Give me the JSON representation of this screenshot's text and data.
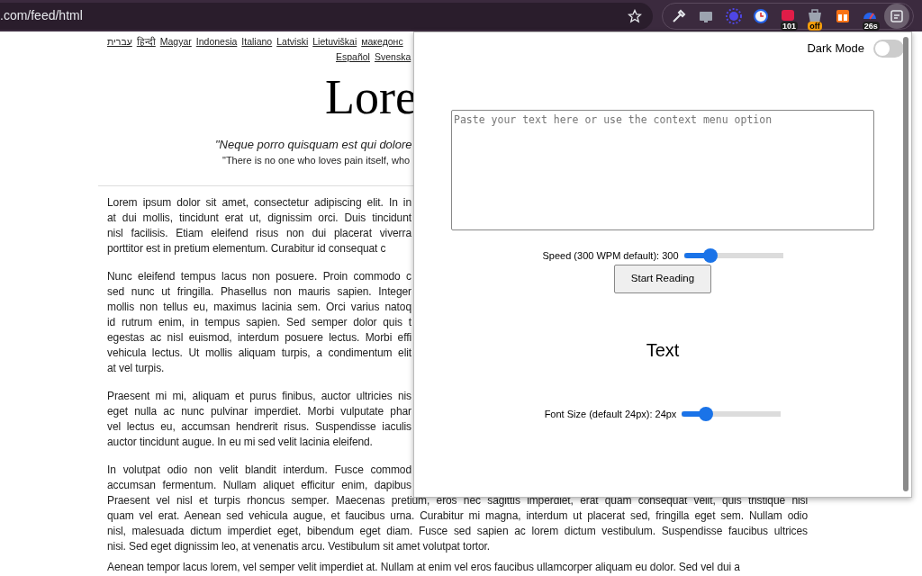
{
  "browser": {
    "url": ".com/feed/html",
    "extensions": [
      {
        "kind": "eyedropper"
      },
      {
        "kind": "screen"
      },
      {
        "kind": "sun"
      },
      {
        "kind": "clock"
      },
      {
        "kind": "calendar",
        "badge": "101"
      },
      {
        "kind": "bag",
        "badge": "off"
      },
      {
        "kind": "grid"
      },
      {
        "kind": "gauge",
        "badge": "26s"
      },
      {
        "kind": "reader",
        "selected": true
      }
    ]
  },
  "page": {
    "languages": [
      [
        "עברית",
        "हिन्दी",
        "Magyar",
        "Indonesia",
        "Italiano",
        "Latviski",
        "Lietuviškai",
        "македонс"
      ],
      [
        "Español",
        "Svenska"
      ]
    ],
    "title": "Lore",
    "quote": "\"Neque porro quisquam est qui dolore",
    "quote_translation": "\"There is no one who loves pain itself, who",
    "paragraphs": [
      {
        "lines": [
          {
            "text": "Lorem ipsum dolor sit amet, consectetur adipiscing elit. In in",
            "covered": true
          },
          {
            "text": "at dui mollis, tincidunt erat ut, dignissim orci. Duis tincidunt",
            "covered": true
          },
          {
            "text": "nisl facilisis. Etiam eleifend risus non dui placerat viverra",
            "covered": true
          },
          {
            "text": "porttitor est in pretium elementum. Curabitur id consequat c",
            "covered": true
          }
        ]
      },
      {
        "lines": [
          {
            "text": "Nunc eleifend tempus lacus non posuere. Proin commodo c",
            "covered": true
          },
          {
            "text": "sed nunc ut fringilla. Phasellus non mauris sapien. Integer",
            "covered": true
          },
          {
            "text": "mollis non tellus eu, maximus lacinia sem. Orci varius natoq",
            "covered": true
          },
          {
            "text": "id rutrum enim, in tempus sapien. Sed semper dolor quis t",
            "covered": true
          },
          {
            "text": "egestas ac nisl euismod, interdum posuere lectus. Morbi effi",
            "covered": true
          },
          {
            "text": "vehicula lectus. Ut mollis aliquam turpis, a condimentum elit",
            "covered": true
          },
          {
            "text": "at vel turpis.",
            "covered": false
          }
        ]
      },
      {
        "lines": [
          {
            "text": "Praesent mi mi, aliquam et purus finibus, auctor ultricies nis",
            "covered": true
          },
          {
            "text": "eget nulla ac nunc pulvinar imperdiet. Morbi vulputate phar",
            "covered": true
          },
          {
            "text": "vel lectus eu, accumsan hendrerit risus. Suspendisse iaculis",
            "covered": true
          },
          {
            "text": "auctor tincidunt augue. In eu mi sed velit lacinia eleifend.",
            "covered": false
          }
        ]
      },
      {
        "lines": [
          {
            "text": "In volutpat odio non velit blandit interdum. Fusce commod",
            "covered": true
          },
          {
            "text": "accumsan fermentum. Nullam aliquet efficitur enim, dapibus",
            "covered": true
          },
          {
            "text": "Praesent vel nisl et turpis rhoncus semper. Maecenas pretium, eros nec sagittis imperdiet, erat quam consequat velit, quis tristique nisl",
            "covered": false
          },
          {
            "text": "quam vel erat. Aenean sed vehicula augue, et faucibus urna. Curabitur mi magna, interdum ut placerat sed, fringilla eget sem. Nullam odio",
            "covered": false
          },
          {
            "text": "nisl, malesuada dictum imperdiet eget, bibendum eget diam. Fusce sed sapien ac lorem dictum vestibulum. Suspendisse faucibus ultrices",
            "covered": false
          },
          {
            "text": "nisi. Sed eget dignissim leo, at venenatis arcu. Vestibulum sit amet volutpat tortor.",
            "covered": false
          }
        ]
      },
      {
        "lines": [
          {
            "text": "Aenean tempor lacus lorem, vel semper velit imperdiet at. Nullam at enim vel eros faucibus ullamcorper aliquam eu dolor. Sed vel dui a",
            "covered": false
          }
        ]
      }
    ]
  },
  "popup": {
    "dark_mode": {
      "label": "Dark Mode",
      "on": false
    },
    "textarea": {
      "placeholder": "Paste your text here or use the context menu option"
    },
    "speed": {
      "label": "Speed (300 WPM default): 300",
      "level": 0.27
    },
    "start_button": "Start Reading",
    "display_word": "Text",
    "font_size": {
      "label": "Font Size (default 24px): 24px",
      "level": 0.24
    }
  }
}
